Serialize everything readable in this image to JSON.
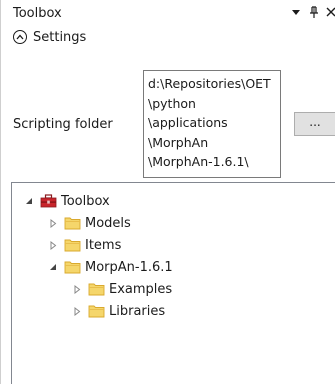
{
  "panel": {
    "title": "Toolbox",
    "icons": {
      "dropdown": "chevron-down-icon",
      "pin": "pin-icon",
      "close": "close-icon"
    }
  },
  "settings": {
    "label": "Settings",
    "icon": "collapse-up-icon",
    "scripting_folder": {
      "label": "Scripting folder",
      "path_lines": [
        "d:\\Repositories\\OET",
        "\\python",
        "\\applications",
        "\\MorphAn",
        "\\MorphAn-1.6.1\\"
      ],
      "browse_label": "..."
    }
  },
  "tree": {
    "nodes": [
      {
        "label": "Toolbox",
        "expanded": true,
        "icon": "toolbox-icon",
        "depth": 0
      },
      {
        "label": "Models",
        "expanded": false,
        "icon": "folder-icon",
        "depth": 1
      },
      {
        "label": "Items",
        "expanded": false,
        "icon": "folder-icon",
        "depth": 1
      },
      {
        "label": "MorpAn-1.6.1",
        "expanded": true,
        "icon": "folder-icon",
        "depth": 1
      },
      {
        "label": "Examples",
        "expanded": false,
        "icon": "folder-icon",
        "depth": 2
      },
      {
        "label": "Libraries",
        "expanded": false,
        "icon": "folder-icon",
        "depth": 2
      }
    ]
  },
  "colors": {
    "folder_fill": "#f5d66b",
    "folder_edge": "#d9a92e",
    "toolbox_red": "#c8242b",
    "tree_border": "#828790"
  }
}
